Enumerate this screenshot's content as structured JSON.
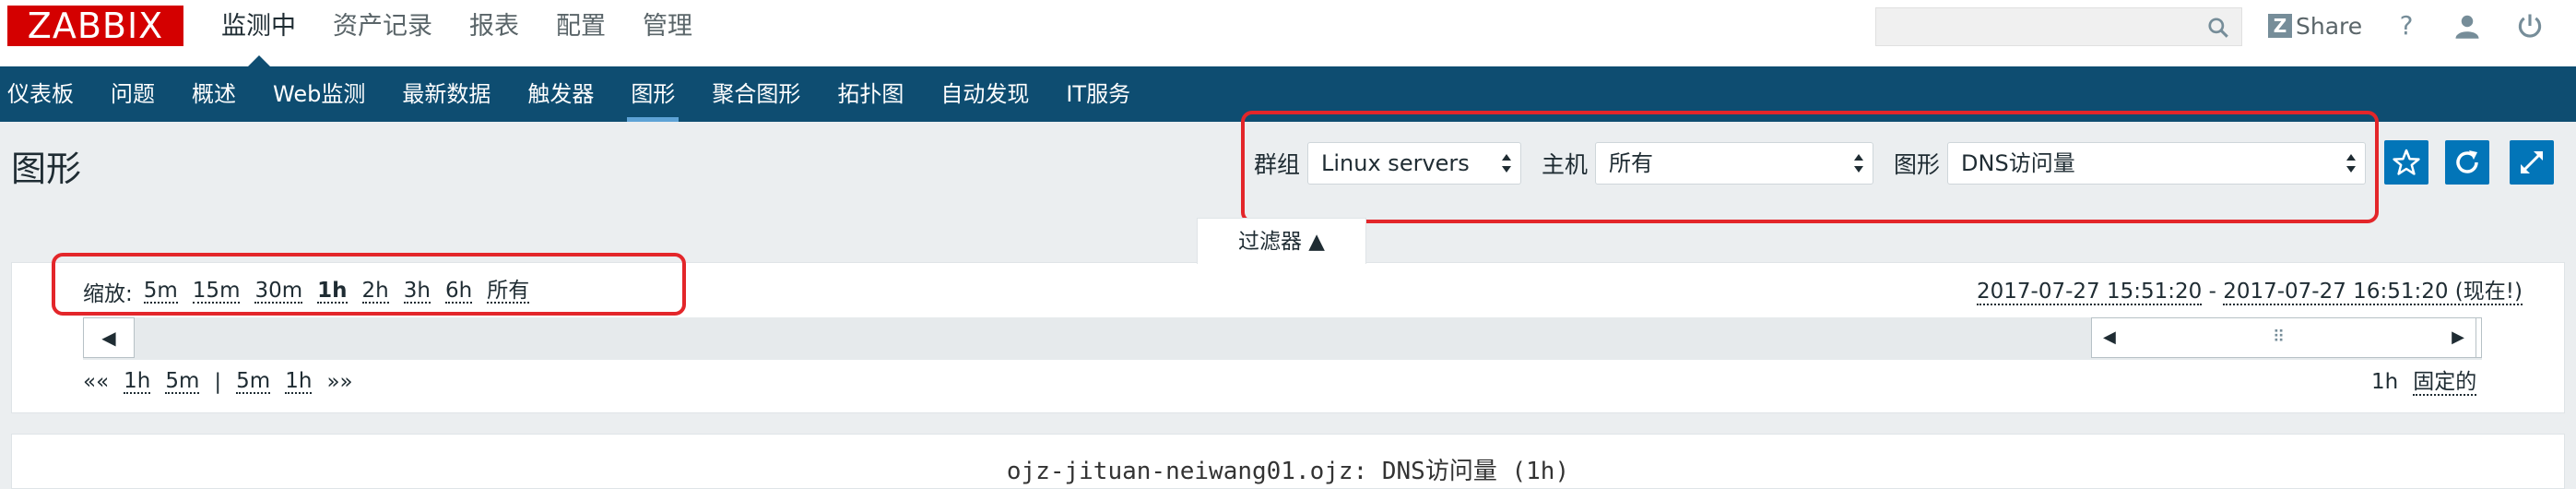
{
  "brand": {
    "logo_text": "ZABBIX",
    "color": "#d40000"
  },
  "main_menu": [
    {
      "label": "监测中",
      "active": true
    },
    {
      "label": "资产记录",
      "active": false
    },
    {
      "label": "报表",
      "active": false
    },
    {
      "label": "配置",
      "active": false
    },
    {
      "label": "管理",
      "active": false
    }
  ],
  "header": {
    "search_placeholder": "",
    "share_label": "Share",
    "share_logo": "Z",
    "help_icon": "?",
    "user_icon": "user-icon",
    "power_icon": "power-icon"
  },
  "sub_menu": [
    {
      "label": "仪表板",
      "active": false
    },
    {
      "label": "问题",
      "active": false
    },
    {
      "label": "概述",
      "active": false
    },
    {
      "label": "Web监测",
      "active": false
    },
    {
      "label": "最新数据",
      "active": false
    },
    {
      "label": "触发器",
      "active": false
    },
    {
      "label": "图形",
      "active": true
    },
    {
      "label": "聚合图形",
      "active": false
    },
    {
      "label": "拓扑图",
      "active": false
    },
    {
      "label": "自动发现",
      "active": false
    },
    {
      "label": "IT服务",
      "active": false
    }
  ],
  "page": {
    "title": "图形",
    "group_label": "群组",
    "group_value": "Linux servers",
    "host_label": "主机",
    "host_value": "所有",
    "graph_label": "图形",
    "graph_value": "DNS访问量"
  },
  "filter": {
    "tab_label": "过滤器 ▲",
    "zoom_label": "缩放:",
    "zoom_options": [
      "5m",
      "15m",
      "30m",
      "1h",
      "2h",
      "3h",
      "6h",
      "所有"
    ],
    "zoom_selected": "1h",
    "range_start": "2017-07-27 15:51:20",
    "range_sep": " - ",
    "range_end": "2017-07-27 16:51:20 (现在!)",
    "nav_left": "◀",
    "nav_right": "▶",
    "slider_left": "◀",
    "slider_right": "▶",
    "slider_grip": "⠿",
    "period_prefix": "««",
    "period_back": [
      "1h",
      "5m"
    ],
    "period_sep": "|",
    "period_fwd": [
      "5m",
      "1h"
    ],
    "period_suffix": "»»",
    "period_value": "1h",
    "fixed_label": "固定的"
  },
  "graph": {
    "title": "ojz-jituan-neiwang01.ojz: DNS访问量 (1h)"
  },
  "colors": {
    "nav_bg": "#0e4d71",
    "accent": "#0275b8",
    "highlight": "#e3262a"
  }
}
